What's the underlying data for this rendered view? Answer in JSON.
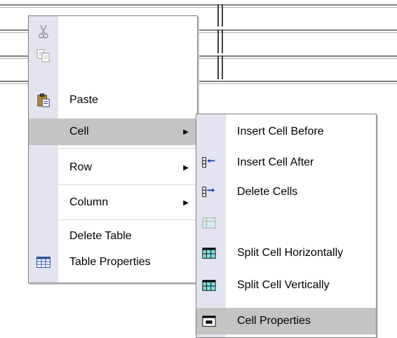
{
  "main_menu": {
    "items": [
      {
        "label": "",
        "icon": "cut-icon",
        "disabled": true
      },
      {
        "label": "",
        "icon": "copy-icon",
        "disabled": true
      },
      {
        "label": "Paste",
        "icon": "paste-icon"
      },
      {
        "label": "Cell",
        "submenu": true,
        "highlighted": true
      },
      {
        "label": "Row",
        "submenu": true
      },
      {
        "label": "Column",
        "submenu": true
      },
      {
        "label": "Delete Table"
      },
      {
        "label": "Table Properties",
        "icon": "table-properties-icon"
      }
    ],
    "submenu_arrow": "▶"
  },
  "sub_menu": {
    "items": [
      {
        "label": "Insert Cell Before"
      },
      {
        "label": "Insert Cell After",
        "icon": "insert-cell-before-icon"
      },
      {
        "label": "Delete Cells",
        "icon": "insert-cell-after-icon"
      },
      {
        "label": "",
        "icon": "delete-cells-icon",
        "disabled": true
      },
      {
        "label": "Split Cell Horizontally",
        "icon": "split-horizontal-icon"
      },
      {
        "label": "Split Cell Vertically",
        "icon": "split-vertical-icon"
      },
      {
        "label": "Cell Properties",
        "icon": "cell-properties-icon",
        "highlighted": true
      }
    ]
  },
  "colors": {
    "gutter": "#e4e4f0",
    "highlight": "#c4c4c4",
    "border": "#808080"
  }
}
